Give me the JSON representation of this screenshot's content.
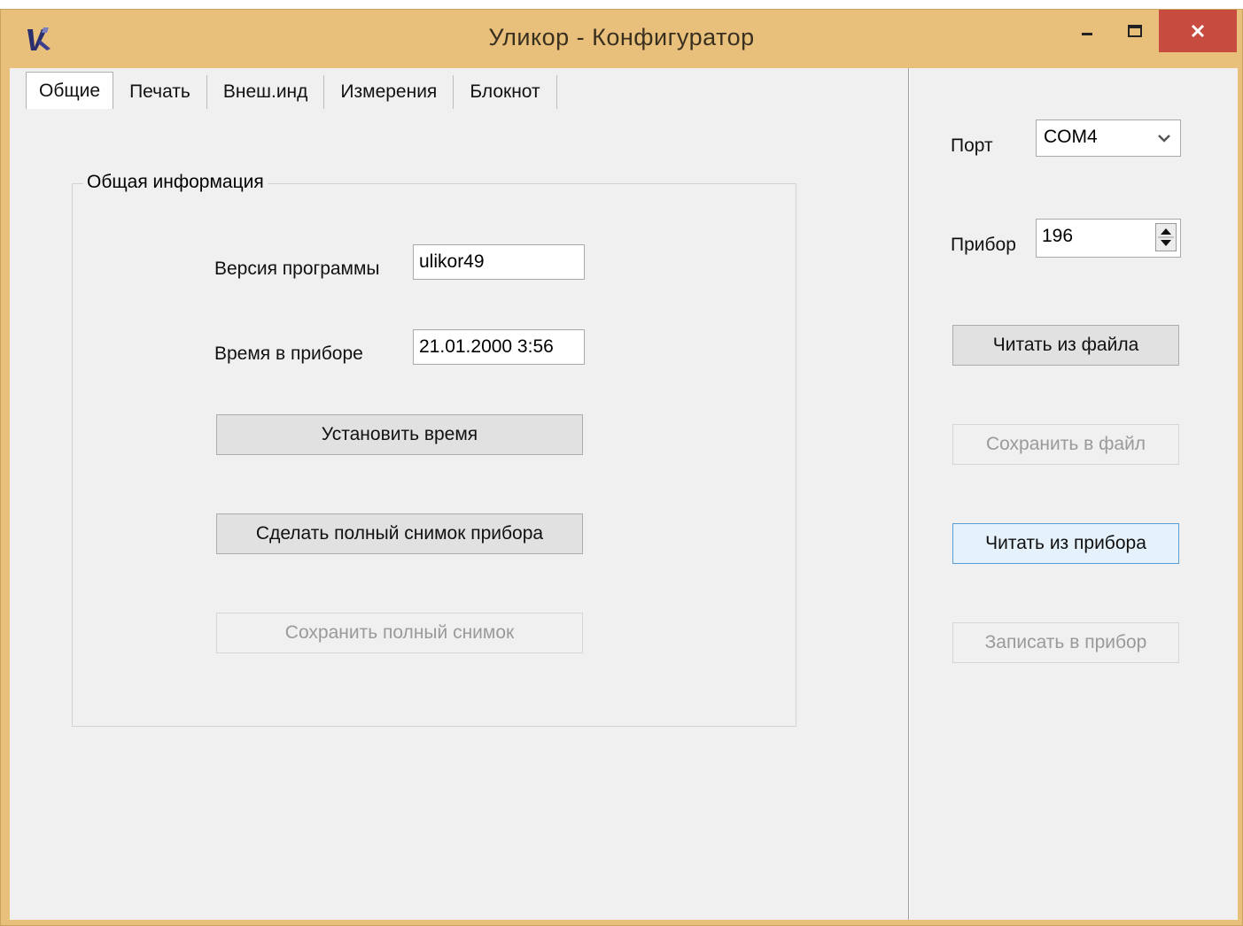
{
  "window": {
    "title": "Уликор - Конфигуратор",
    "title_bg": "#e8c07b",
    "close_color": "#c74b3f"
  },
  "tabs": [
    {
      "label": "Общие",
      "active": true
    },
    {
      "label": "Печать",
      "active": false
    },
    {
      "label": "Внеш.инд",
      "active": false
    },
    {
      "label": "Измерения",
      "active": false
    },
    {
      "label": "Блокнот",
      "active": false
    }
  ],
  "general": {
    "group_title": "Общая информация",
    "version_label": "Версия программы",
    "version_value": "ulikor49",
    "time_label": "Время в приборе",
    "time_value": "21.01.2000  3:56",
    "set_time_button": "Установить время",
    "full_snapshot_button": "Сделать полный снимок прибора",
    "save_snapshot_button": "Сохранить полный снимок"
  },
  "side": {
    "port_label": "Порт",
    "port_value": "COM4",
    "device_label": "Прибор",
    "device_value": "196",
    "read_file_button": "Читать из файла",
    "save_file_button": "Сохранить в файл",
    "read_device_button": "Читать из прибора",
    "write_device_button": "Записать в прибор"
  }
}
